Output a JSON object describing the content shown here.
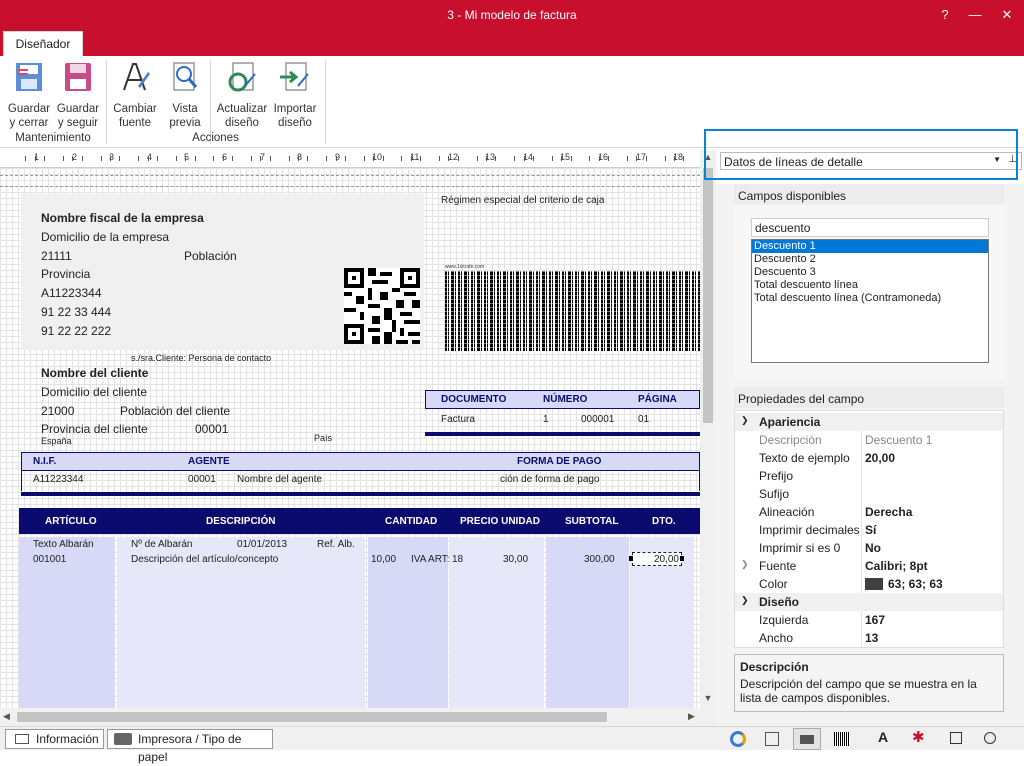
{
  "window": {
    "title": "3 - Mi modelo de factura"
  },
  "ribbon": {
    "tab": "Diseñador",
    "buttons": [
      {
        "line1": "Guardar",
        "line2": "y cerrar",
        "icon": "save-close-icon"
      },
      {
        "line1": "Guardar",
        "line2": "y seguir",
        "icon": "save-icon"
      },
      {
        "line1": "Cambiar",
        "line2": "fuente",
        "icon": "font-icon"
      },
      {
        "line1": "Vista",
        "line2": "previa",
        "icon": "preview-icon"
      },
      {
        "line1": "Actualizar",
        "line2": "diseño",
        "icon": "refresh-design-icon"
      },
      {
        "line1": "Importar",
        "line2": "diseño",
        "icon": "import-design-icon"
      }
    ],
    "groups": [
      "Mantenimiento",
      "Acciones"
    ]
  },
  "ruler": {
    "marks": [
      "1",
      "2",
      "3",
      "4",
      "5",
      "6",
      "7",
      "8",
      "9",
      "10",
      "11",
      "12",
      "13",
      "14",
      "15",
      "16",
      "17",
      "18"
    ]
  },
  "invoice": {
    "regime": "Régimen especial del criterio de caja",
    "company": {
      "name": "Nombre fiscal de la empresa",
      "address": "Domicilio de la empresa",
      "zip": "21111",
      "city": "Población",
      "province": "Provincia",
      "nif": "A11223344",
      "phone1": "91 22 33 444",
      "phone2": "91 22 22 222"
    },
    "barcode_caption": "www.1dcode.com",
    "contact": "s./sra.Cliente: Persona de contacto",
    "client": {
      "name": "Nombre del cliente",
      "address": "Domicilio del cliente",
      "zip": "21000",
      "city": "Población del cliente",
      "province": "Provincia del cliente",
      "code": "00001",
      "country": "España",
      "country_label": "País"
    },
    "doc_headers": [
      "DOCUMENTO",
      "NÚMERO",
      "PÁGINA"
    ],
    "doc_values": [
      "Factura",
      "1",
      "000001",
      "01"
    ],
    "nif_headers": [
      "N.I.F.",
      "AGENTE",
      "FORMA DE PAGO"
    ],
    "nif_values": [
      "A11223344",
      "00001",
      "Nombre del agente",
      "ción de forma de pago"
    ],
    "line_headers": [
      "ARTÍCULO",
      "DESCRIPCIÓN",
      "CANTIDAD",
      "PRECIO UNIDAD",
      "SUBTOTAL",
      "DTO."
    ],
    "line": {
      "art_text": "Texto Albarán",
      "art_code": "001001",
      "albaran_label": "Nº de Albarán",
      "albaran_date": "01/01/2013",
      "albaran_ref": "Ref. Alb.",
      "description": "Descripción del artículo/concepto",
      "quantity": "10,00",
      "iva_label": "IVA ART:",
      "iva_value": "18",
      "price": "30,00",
      "subtotal": "300,00",
      "discount": "20,00"
    }
  },
  "panel": {
    "dropdown": "Datos de líneas de detalle",
    "available_title": "Campos disponibles",
    "search_value": "descuento",
    "fields": [
      "Descuento 1",
      "Descuento 2",
      "Descuento 3",
      "Total descuento línea",
      "Total descuento línea (Contramoneda)"
    ],
    "props_title": "Propiedades del campo",
    "cat_appearance": "Apariencia",
    "cat_design": "Diseño",
    "props": [
      {
        "k": "Descripción",
        "v": "Descuento 1"
      },
      {
        "k": "Texto de ejemplo",
        "v": "20,00"
      },
      {
        "k": "Prefijo",
        "v": ""
      },
      {
        "k": "Sufijo",
        "v": ""
      },
      {
        "k": "Alineación",
        "v": "Derecha"
      },
      {
        "k": "Imprimir decimales",
        "v": "Sí"
      },
      {
        "k": "Imprimir si es 0",
        "v": "No"
      },
      {
        "k": "Fuente",
        "v": "Calibri; 8pt"
      },
      {
        "k": "Color",
        "v": "63; 63; 63"
      }
    ],
    "design_props": [
      {
        "k": "Izquierda",
        "v": "167"
      },
      {
        "k": "Ancho",
        "v": "13"
      }
    ],
    "desc_title": "Descripción",
    "desc_text": "Descripción del campo que se muestra en la lista de campos disponibles.",
    "color_swatch": "#3f3f3f"
  },
  "bottom": {
    "tab1": "Información",
    "tab2": "Impresora / Tipo de papel",
    "tools": [
      "palette-icon",
      "ruler-tool-icon",
      "print-tool-icon",
      "barcode-tool-icon",
      "text-tool-icon",
      "line-tool-icon",
      "rectangle-tool-icon",
      "ellipse-tool-icon"
    ]
  },
  "colors": {
    "brand": "#c8102e",
    "navy": "#0b0b6f",
    "lavender": "#d7d9f7",
    "selection": "#0078d7"
  }
}
